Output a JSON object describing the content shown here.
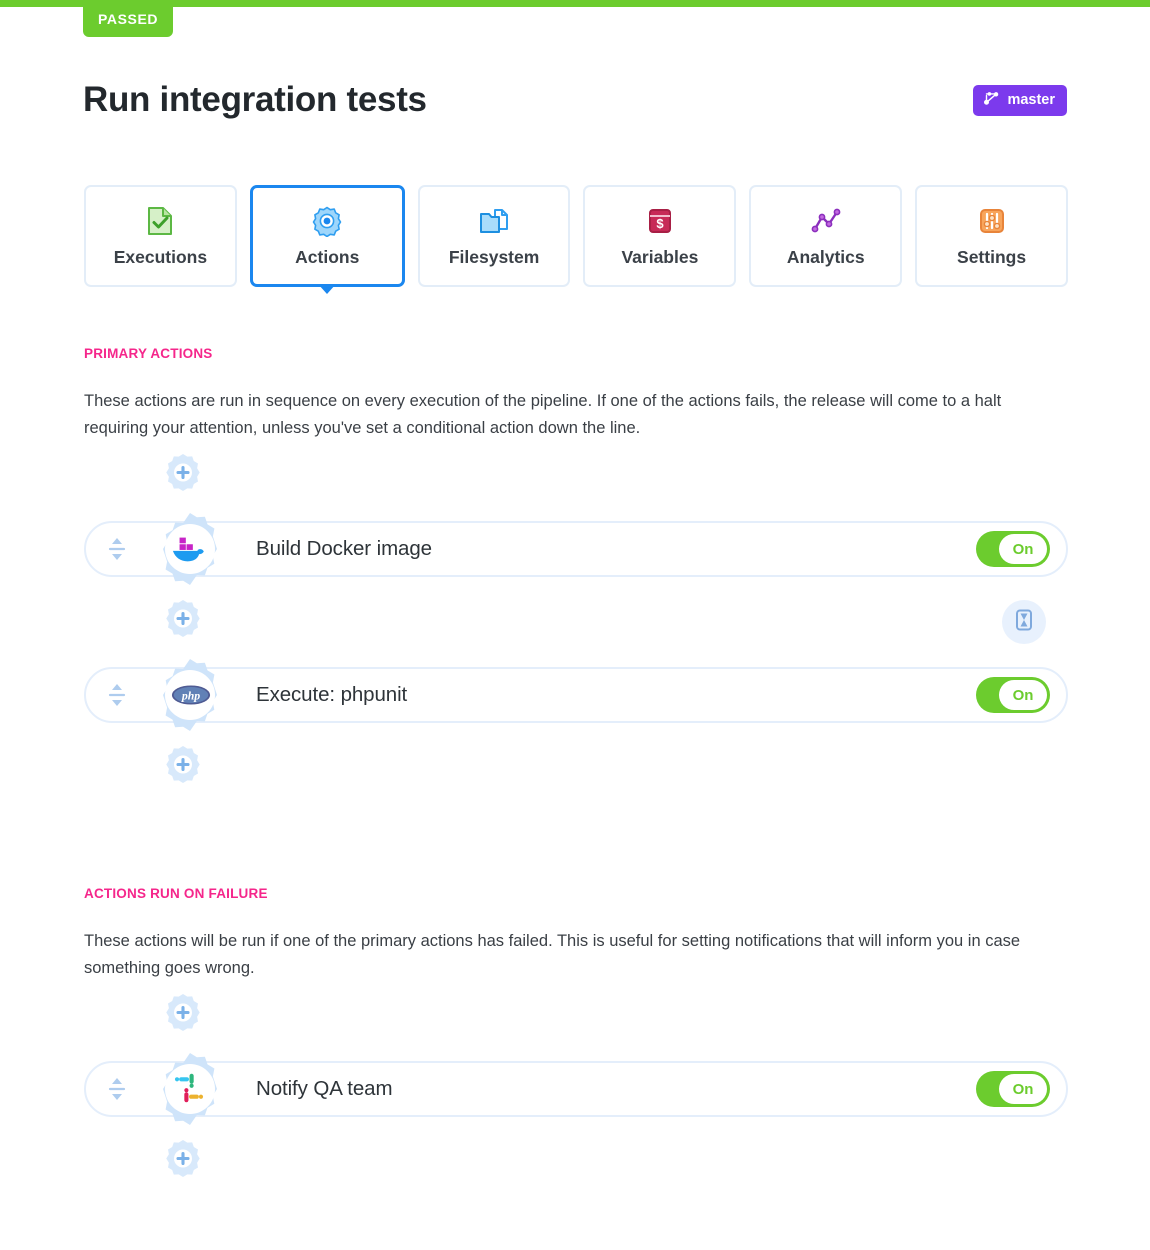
{
  "status": {
    "label": "PASSED",
    "color": "#6ccc2e"
  },
  "header": {
    "title": "Run integration tests",
    "branch": {
      "label": "master",
      "icon": "git-branch-icon",
      "color": "#7c3aed"
    }
  },
  "tabs": [
    {
      "label": "Executions",
      "icon": "document-check-icon",
      "active": false
    },
    {
      "label": "Actions",
      "icon": "gear-icon",
      "active": true
    },
    {
      "label": "Filesystem",
      "icon": "folder-file-icon",
      "active": false
    },
    {
      "label": "Variables",
      "icon": "dollar-box-icon",
      "active": false
    },
    {
      "label": "Analytics",
      "icon": "line-chart-icon",
      "active": false
    },
    {
      "label": "Settings",
      "icon": "sliders-icon",
      "active": false
    }
  ],
  "sections": [
    {
      "heading": "PRIMARY ACTIONS",
      "description": "These actions are run in sequence on every execution of the pipeline. If one of the actions fails, the release will come to a halt requiring your attention, unless you've set a conditional action down the line.",
      "actions": [
        {
          "title": "Build Docker image",
          "icon": "docker-icon",
          "toggle": "On",
          "has_timer": true
        },
        {
          "title": "Execute: phpunit",
          "icon": "php-icon",
          "toggle": "On",
          "has_timer": false
        }
      ]
    },
    {
      "heading": "ACTIONS RUN ON FAILURE",
      "description": "These actions will be run if one of the primary actions has failed. This is useful for setting notifications that will inform you in case something goes wrong.",
      "actions": [
        {
          "title": "Notify QA team",
          "icon": "slack-icon",
          "toggle": "On",
          "has_timer": false
        }
      ]
    }
  ],
  "controls": {
    "add_action_icon": "gear-plus-icon",
    "drag_handle_icon": "reorder-arrows-icon",
    "timer_icon": "hourglass-icon"
  },
  "accent_colors": {
    "green": "#6ccc2e",
    "pink": "#f5268b",
    "blue": "#1b87ef",
    "purple": "#7c3aed",
    "light_blue": "#cfe4fa"
  }
}
